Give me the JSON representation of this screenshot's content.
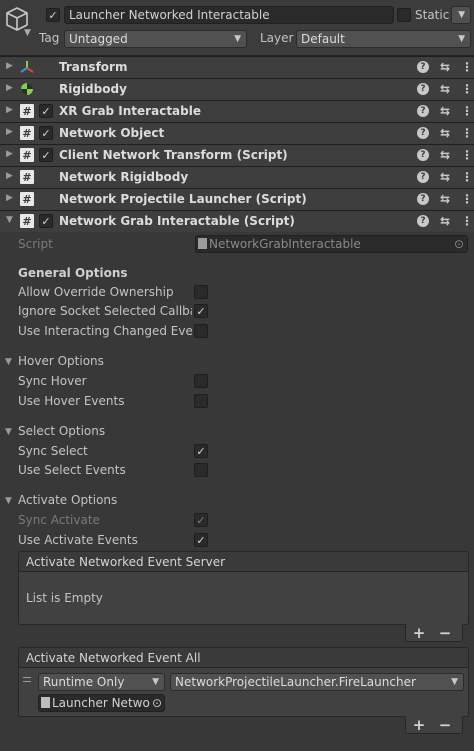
{
  "header": {
    "object_name": "Launcher Networked Interactable",
    "active": true,
    "static_label": "Static",
    "static_checked": false,
    "tag_label": "Tag",
    "tag_value": "Untagged",
    "layer_label": "Layer",
    "layer_value": "Default"
  },
  "components": [
    {
      "name": "Transform",
      "has_checkbox": false,
      "checked": false,
      "icon": "transform-icon"
    },
    {
      "name": "Rigidbody",
      "has_checkbox": false,
      "checked": false,
      "icon": "rigidbody-icon"
    },
    {
      "name": "XR Grab Interactable",
      "has_checkbox": true,
      "checked": true,
      "icon": "script-icon"
    },
    {
      "name": "Network Object",
      "has_checkbox": true,
      "checked": true,
      "icon": "script-icon"
    },
    {
      "name": "Client Network Transform (Script)",
      "has_checkbox": true,
      "checked": true,
      "icon": "script-icon"
    },
    {
      "name": "Network Rigidbody",
      "has_checkbox": false,
      "checked": false,
      "icon": "script-icon"
    },
    {
      "name": "Network Projectile Launcher (Script)",
      "has_checkbox": false,
      "checked": false,
      "icon": "script-icon"
    },
    {
      "name": "Network Grab Interactable (Script)",
      "has_checkbox": true,
      "checked": true,
      "icon": "script-icon",
      "expanded": true
    }
  ],
  "inspector": {
    "script_label": "Script",
    "script_value": "NetworkGrabInteractable",
    "general_options": {
      "title": "General Options",
      "allow_override_ownership": {
        "label": "Allow Override Ownership",
        "checked": false
      },
      "ignore_socket_selected_callback": {
        "label": "Ignore Socket Selected Callbac",
        "checked": true
      },
      "use_interacting_changed_event": {
        "label": "Use Interacting Changed Event",
        "checked": false
      }
    },
    "hover_options": {
      "title": "Hover Options",
      "sync_hover": {
        "label": "Sync Hover",
        "checked": false
      },
      "use_hover_events": {
        "label": "Use Hover Events",
        "checked": false
      }
    },
    "select_options": {
      "title": "Select Options",
      "sync_select": {
        "label": "Sync Select",
        "checked": true
      },
      "use_select_events": {
        "label": "Use Select Events",
        "checked": false
      }
    },
    "activate_options": {
      "title": "Activate Options",
      "sync_activate": {
        "label": "Sync Activate",
        "checked": true,
        "disabled": true
      },
      "use_activate_events": {
        "label": "Use Activate Events",
        "checked": true
      }
    },
    "event_server": {
      "title": "Activate Networked Event Server",
      "empty_text": "List is Empty",
      "add": "+",
      "remove": "−"
    },
    "event_all": {
      "title": "Activate Networked Event All",
      "runtime_value": "Runtime Only",
      "function_value": "NetworkProjectileLauncher.FireLauncher",
      "object_value": "Launcher Netwo",
      "add": "+",
      "remove": "−"
    }
  }
}
